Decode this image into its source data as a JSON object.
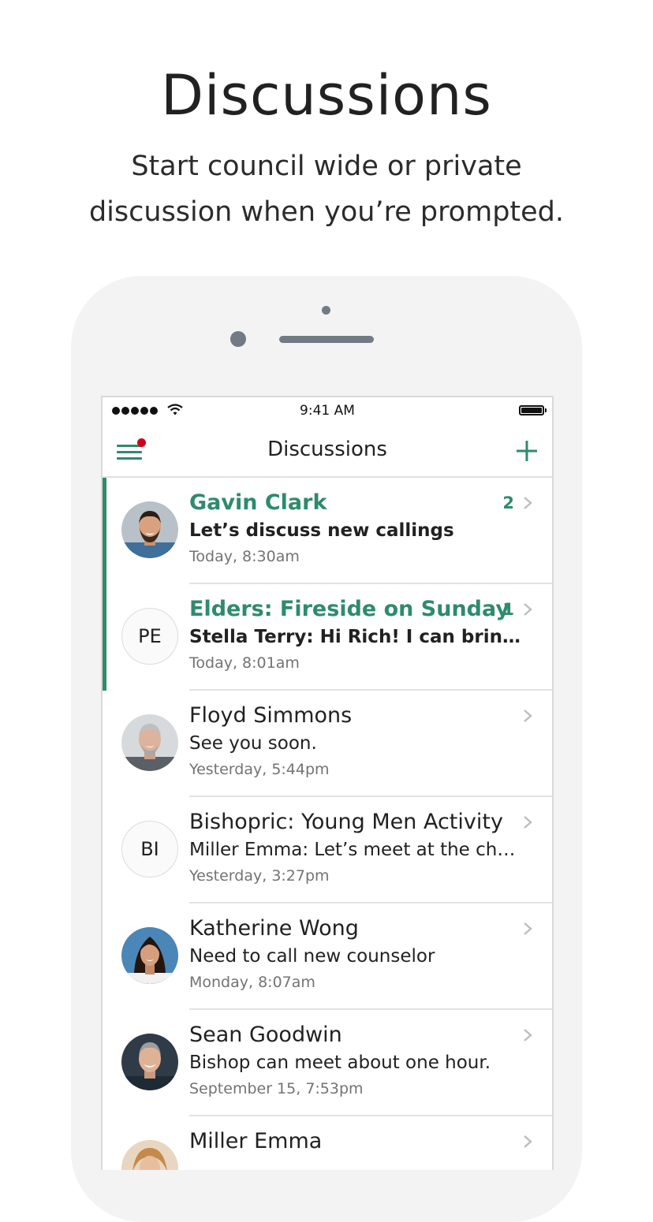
{
  "hero": {
    "title": "Discussions",
    "subtitle_line1": "Start council wide or private",
    "subtitle_line2": "discussion when you’re prompted."
  },
  "status_bar": {
    "time": "9:41 AM"
  },
  "nav": {
    "title": "Discussions"
  },
  "colors": {
    "accent": "#2e8b6b",
    "badge": "#d0021b",
    "divider": "#e3e3e3",
    "muted_text": "#737373"
  },
  "discussions": [
    {
      "name": "Gavin Clark",
      "preview": "Let’s discuss new callings",
      "timestamp": "Today, 8:30am",
      "unread_count": "2",
      "avatar": "photo"
    },
    {
      "name": "Elders: Fireside on Sunday",
      "preview": "Stella Terry: Hi Rich! I can bring arr...",
      "timestamp": "Today, 8:01am",
      "unread_count": "1",
      "initials": "PE"
    },
    {
      "name": "Floyd Simmons",
      "preview": "See you soon.",
      "timestamp": "Yesterday, 5:44pm",
      "avatar": "photo"
    },
    {
      "name": "Bishopric: Young Men Activity",
      "preview": "Miller Emma: Let’s meet at the churc...",
      "timestamp": "Yesterday, 3:27pm",
      "initials": "BI"
    },
    {
      "name": "Katherine Wong",
      "preview": "Need to call new counselor",
      "timestamp": "Monday, 8:07am",
      "avatar": "photo"
    },
    {
      "name": "Sean Goodwin",
      "preview": "Bishop can meet about one hour.",
      "timestamp": "September 15, 7:53pm",
      "avatar": "photo"
    },
    {
      "name": "Miller Emma",
      "avatar": "photo"
    }
  ]
}
